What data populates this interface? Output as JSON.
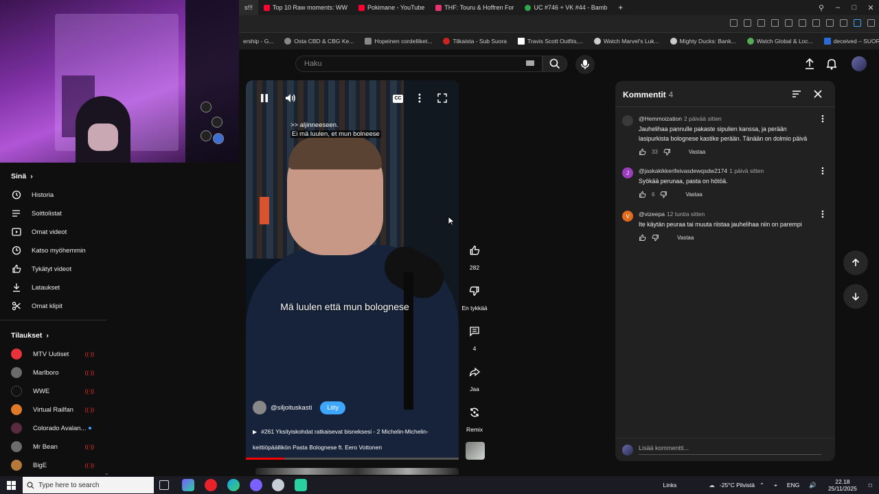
{
  "browser": {
    "tabs": [
      {
        "label": "s!!!",
        "color": "#888888"
      },
      {
        "label": "Top 10 Raw moments: WW",
        "color": "#ff0033"
      },
      {
        "label": "Pokimane - YouTube",
        "color": "#ff0033"
      },
      {
        "label": "THF: Touru & Hoffren For",
        "color": "#e8336d"
      },
      {
        "label": "UC #746 + VK #44 - Bamb",
        "color": "#2ea84a"
      }
    ],
    "new_tab": "+",
    "bookmarks": [
      {
        "label": "ership - G..."
      },
      {
        "label": "Osta CBD & CBG Ke..."
      },
      {
        "label": "Hopeinen cordelliket..."
      },
      {
        "label": "Tilkaista - Sub Suora"
      },
      {
        "label": "Travis Scott Outfits,..."
      },
      {
        "label": "Watch Marvel's Luk..."
      },
      {
        "label": "Mighty Ducks: Bank..."
      },
      {
        "label": "Watch Global & Loc..."
      },
      {
        "label": "deceived – SUORAT..."
      }
    ]
  },
  "header": {
    "search_placeholder": "Haku"
  },
  "sidebar": {
    "you_title": "Sinä",
    "you_items": [
      {
        "label": "Historia",
        "icon": "history-icon"
      },
      {
        "label": "Soittolistat",
        "icon": "playlists-icon"
      },
      {
        "label": "Omat videot",
        "icon": "your-videos-icon"
      },
      {
        "label": "Katso myöhemmin",
        "icon": "watch-later-icon"
      },
      {
        "label": "Tykätyt videot",
        "icon": "liked-videos-icon"
      },
      {
        "label": "Lataukset",
        "icon": "downloads-icon"
      },
      {
        "label": "Omat klipit",
        "icon": "clips-icon"
      }
    ],
    "subs_title": "Tilaukset",
    "subscriptions": [
      {
        "label": "MTV Uutiset",
        "color": "#e8333a",
        "status": "live"
      },
      {
        "label": "Marlboro",
        "color": "#6b6b6b",
        "status": "live"
      },
      {
        "label": "WWE",
        "color": "#111111",
        "status": "live"
      },
      {
        "label": "Virtual Railfan",
        "color": "#e07a2b",
        "status": "live"
      },
      {
        "label": "Colorado Avalan...",
        "color": "#5a2a3e",
        "status": "new"
      },
      {
        "label": "Mr Bean",
        "color": "#6c6c6c",
        "status": "live"
      },
      {
        "label": "BigE",
        "color": "#b57a3a",
        "status": "live"
      }
    ],
    "live_glyph": "((·))"
  },
  "video": {
    "top_caption_line1": ">> aljinneeseen.",
    "top_caption_line2": "Ei mä luulen, et mun bolneese",
    "big_caption": "Mä luulen että mun bolognese",
    "channel": "@siljoituskasti",
    "join_label": "Liity",
    "title": "#261 Yksityiskohdat ratkaisevat bisneksesi - 2 Michelin-Michelin-keittiöpäällikön Pasta Bolognese ft. Eero Vottonen",
    "progress": 0.18
  },
  "actions": {
    "like_count": "282",
    "dislike_label": "En tykkää",
    "comments_count": "4",
    "share_label": "Jaa",
    "remix_label": "Remix"
  },
  "comments": {
    "title": "Kommentit",
    "count": "4",
    "items": [
      {
        "author": "@Hemmoization",
        "time": "2 päivää sitten",
        "text": "Jauhelihaa pannulle pakaste sipulien kanssa, ja perään lasipurkista bolognese kastike perään. Tänään on dolmio päivä",
        "likes": "33",
        "avatar_letter": "",
        "avatar_color": "#3a3a3a"
      },
      {
        "author": "@jaskakikkerifeivasdewqsdw2174",
        "time": "1 päivä sitten",
        "text": "Syökää perunaa, pasta on hötöä.",
        "likes": "6",
        "avatar_letter": "J",
        "avatar_color": "#9c3fbf"
      },
      {
        "author": "@vizeepa",
        "time": "12 tuntia sitten",
        "text": "Ite käytän peuraa tai muuta riistaa jauhelihaa niin on parempi",
        "likes": "",
        "avatar_letter": "V",
        "avatar_color": "#e06b1f"
      }
    ],
    "reply_label": "Vastaa",
    "add_placeholder": "Lisää kommentti..."
  },
  "taskbar": {
    "search_placeholder": "Type here to search",
    "links_label": "Links",
    "weather": "-25°C Pilvistä",
    "lang": "ENG",
    "time": "22.18",
    "date": "25/11/2025"
  }
}
